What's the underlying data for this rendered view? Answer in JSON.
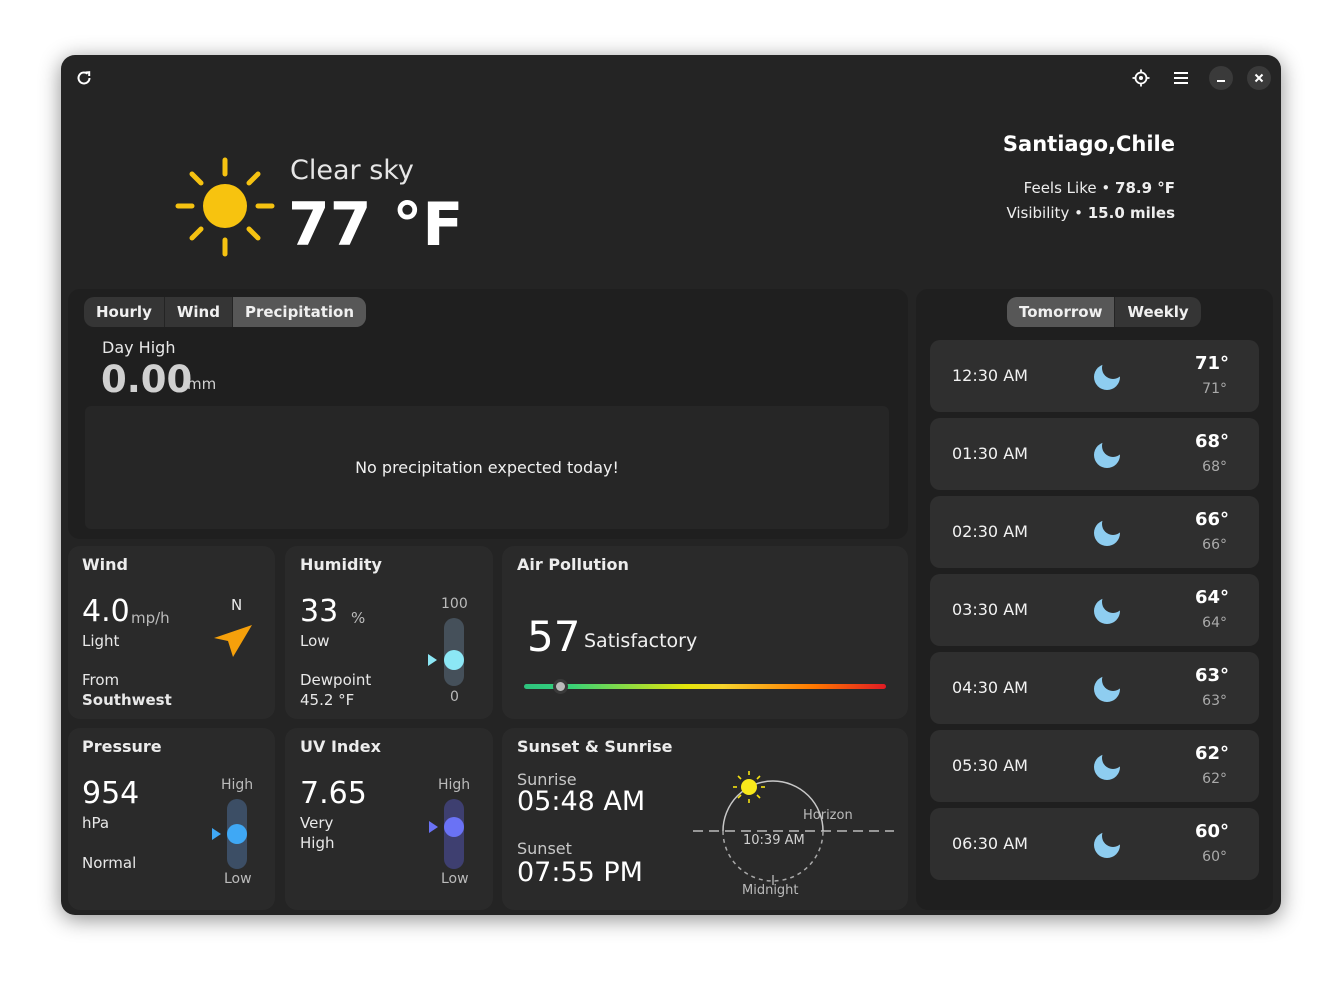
{
  "window": {
    "icons": [
      "refresh-icon",
      "location-icon",
      "menu-icon",
      "minimize-icon",
      "close-icon"
    ]
  },
  "current": {
    "condition": "Clear sky",
    "temperature": "77 °F",
    "icon": "sun-icon"
  },
  "location": {
    "city": "Santiago,Chile",
    "feels_like_label": "Feels Like",
    "feels_like_value": "78.9 °F",
    "visibility_label": "Visibility",
    "visibility_value": "15.0 miles",
    "separator": "•"
  },
  "forecast_tabs": {
    "items": [
      "Hourly",
      "Wind",
      "Precipitation"
    ],
    "active": "Precipitation"
  },
  "precipitation": {
    "label": "Day High",
    "value": "0.00",
    "unit": "mm",
    "message": "No precipitation expected today!"
  },
  "wind": {
    "title": "Wind",
    "speed": "4.0",
    "unit": "mp/h",
    "description": "Light",
    "from_label": "From",
    "direction": "Southwest",
    "compass_label": "N",
    "arrow_color": "#f5a00b"
  },
  "humidity": {
    "title": "Humidity",
    "value": "33",
    "unit": "%",
    "description": "Low",
    "dewpoint_label": "Dewpoint",
    "dewpoint_value": "45.2 °F",
    "scale_max": "100",
    "scale_min": "0",
    "level": 0.33,
    "knob_color": "#8ce7f5"
  },
  "air_pollution": {
    "title": "Air Pollution",
    "value": "57",
    "description": "Satisfactory",
    "level": 0.1
  },
  "pressure": {
    "title": "Pressure",
    "value": "954",
    "unit": "hPa",
    "description": "Normal",
    "scale_high": "High",
    "scale_low": "Low",
    "level": 0.5,
    "knob_color": "#3fa8f5"
  },
  "uv_index": {
    "title": "UV Index",
    "value": "7.65",
    "description_line1": "Very",
    "description_line2": "High",
    "scale_high": "High",
    "scale_low": "Low",
    "level": 0.65,
    "knob_color": "#6a72f5"
  },
  "sun": {
    "title": "Sunset & Sunrise",
    "sunrise_label": "Sunrise",
    "sunrise_time": "05:48 AM",
    "sunset_label": "Sunset",
    "sunset_time": "07:55 PM",
    "current_time": "10:39 AM",
    "horizon_label": "Horizon",
    "midnight_label": "Midnight"
  },
  "side_tabs": {
    "items": [
      "Tomorrow",
      "Weekly"
    ],
    "active": "Tomorrow"
  },
  "hourly": [
    {
      "time": "12:30 AM",
      "icon": "moon-icon",
      "high": "71°",
      "low": "71°"
    },
    {
      "time": "01:30 AM",
      "icon": "moon-icon",
      "high": "68°",
      "low": "68°"
    },
    {
      "time": "02:30 AM",
      "icon": "moon-icon",
      "high": "66°",
      "low": "66°"
    },
    {
      "time": "03:30 AM",
      "icon": "moon-icon",
      "high": "64°",
      "low": "64°"
    },
    {
      "time": "04:30 AM",
      "icon": "moon-icon",
      "high": "63°",
      "low": "63°"
    },
    {
      "time": "05:30 AM",
      "icon": "moon-icon",
      "high": "62°",
      "low": "62°"
    },
    {
      "time": "06:30 AM",
      "icon": "moon-icon",
      "high": "60°",
      "low": "60°"
    }
  ]
}
